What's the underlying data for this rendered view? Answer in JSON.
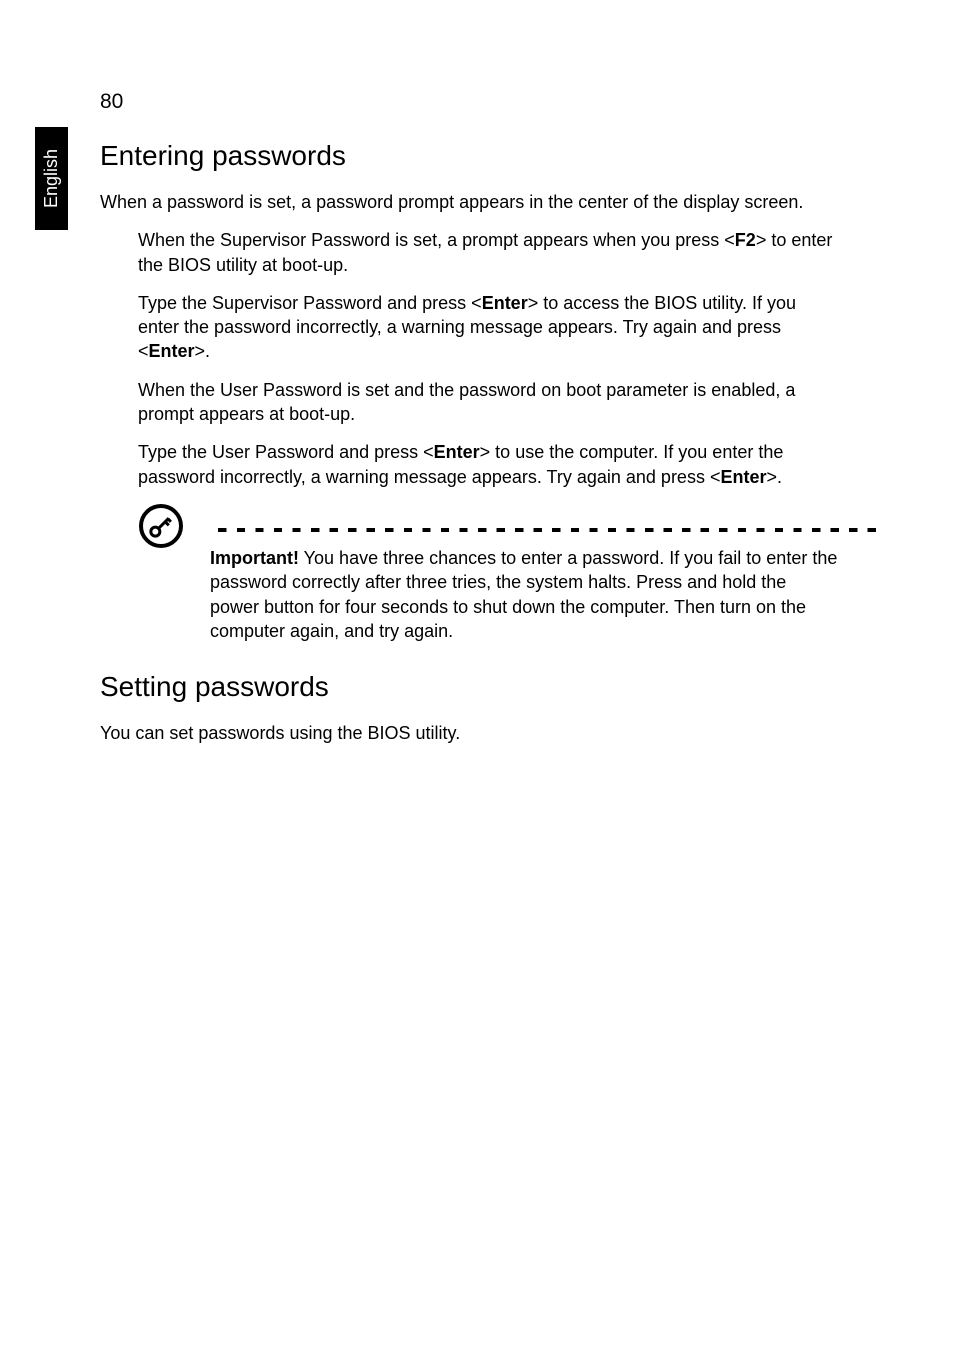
{
  "side_tab": "English",
  "page_number": "80",
  "section1": {
    "heading": "Entering passwords",
    "intro": "When a password is set, a password prompt appears in the center of the display screen.",
    "para1_a": "When the Supervisor Password is set, a prompt appears when you press <",
    "para1_key": "F2",
    "para1_b": "> to enter the BIOS utility at boot-up.",
    "para2_a": "Type the Supervisor Password and press <",
    "para2_key1": "Enter",
    "para2_b": "> to access the BIOS utility. If you enter the password incorrectly, a warning message appears. Try again and press <",
    "para2_key2": "Enter",
    "para2_c": ">.",
    "para3": "When the User Password is set and the password on boot parameter is enabled, a prompt appears at boot-up.",
    "para4_a": "Type the User Password and press <",
    "para4_key1": "Enter",
    "para4_b": "> to use the computer. If you enter the password incorrectly, a warning message appears. Try again and press <",
    "para4_key2": "Enter",
    "para4_c": ">.",
    "note_label": "Important!",
    "note_text": " You have three chances to enter a password. If you fail to enter the password correctly after three tries, the system halts. Press and hold the power button for four seconds to shut down the computer. Then turn on the computer again, and try again."
  },
  "section2": {
    "heading": "Setting passwords",
    "body": "You can set passwords using the BIOS utility."
  }
}
